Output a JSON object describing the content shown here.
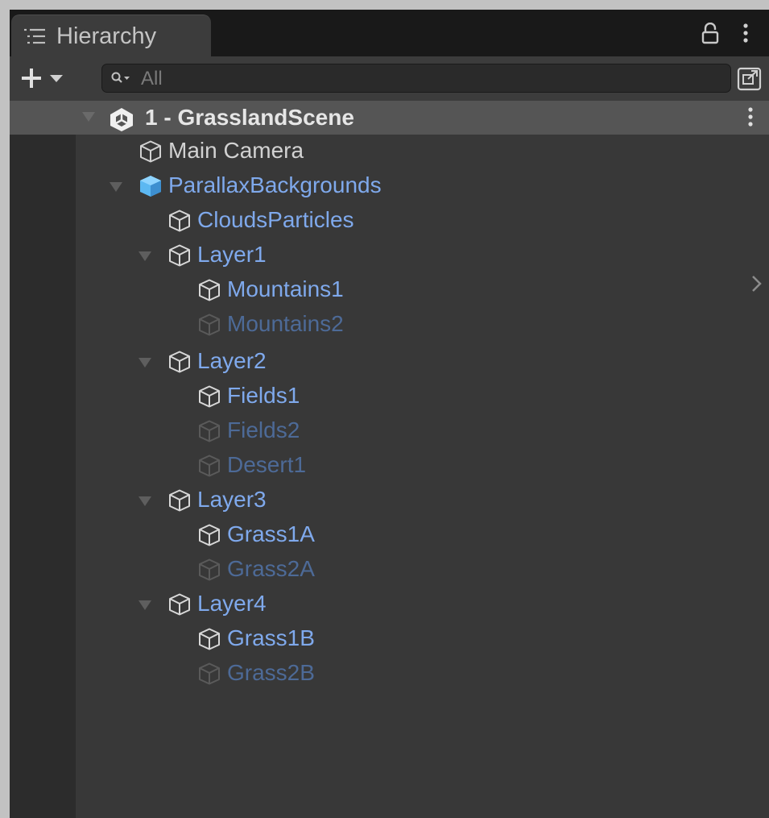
{
  "window": {
    "tab_title": "Hierarchy"
  },
  "toolbar": {
    "search_placeholder": "All"
  },
  "hierarchy": {
    "scene": {
      "label": "1 - GrasslandScene",
      "expanded": true
    },
    "items": [
      {
        "label": "Main Camera",
        "depth": 1,
        "style": "normal",
        "foldout": null
      },
      {
        "label": "ParallaxBackgrounds",
        "depth": 1,
        "style": "prefab-root",
        "foldout": "expanded"
      },
      {
        "label": "CloudsParticles",
        "depth": 2,
        "style": "prefab",
        "foldout": null
      },
      {
        "label": "Layer1",
        "depth": 2,
        "style": "prefab",
        "foldout": "expanded"
      },
      {
        "label": "Mountains1",
        "depth": 3,
        "style": "prefab",
        "foldout": null
      },
      {
        "label": "Mountains2",
        "depth": 3,
        "style": "prefab-inactive",
        "foldout": null
      },
      {
        "label": "Layer2",
        "depth": 2,
        "style": "prefab",
        "foldout": "expanded"
      },
      {
        "label": "Fields1",
        "depth": 3,
        "style": "prefab",
        "foldout": null
      },
      {
        "label": "Fields2",
        "depth": 3,
        "style": "prefab-inactive",
        "foldout": null
      },
      {
        "label": "Desert1",
        "depth": 3,
        "style": "prefab-inactive",
        "foldout": null
      },
      {
        "label": "Layer3",
        "depth": 2,
        "style": "prefab",
        "foldout": "expanded"
      },
      {
        "label": "Grass1A",
        "depth": 3,
        "style": "prefab",
        "foldout": null
      },
      {
        "label": "Grass2A",
        "depth": 3,
        "style": "prefab-inactive",
        "foldout": null
      },
      {
        "label": "Layer4",
        "depth": 2,
        "style": "prefab",
        "foldout": "expanded"
      },
      {
        "label": "Grass1B",
        "depth": 3,
        "style": "prefab",
        "foldout": null
      },
      {
        "label": "Grass2B",
        "depth": 3,
        "style": "prefab-inactive",
        "foldout": null
      }
    ]
  },
  "colors": {
    "panel_bg": "#383838",
    "selected_scene_row": "#555555",
    "prefab_text": "#7fa9ec",
    "prefab_inactive_text": "#4d6a97",
    "normal_text": "#d2d2d2",
    "prefab_icon": "#5cb8f2"
  },
  "icons": {
    "tab": "list-icon",
    "lock": "lock-icon",
    "menu": "kebab-menu-icon",
    "create": "plus-dropdown-icon",
    "search": "search-icon",
    "scene_toggle": "scene-view-icon",
    "scene": "unity-logo-icon",
    "gameobject": "cube-outline-icon",
    "prefab_root": "prefab-cube-icon",
    "expand_arrow": "chevron-right-icon"
  }
}
